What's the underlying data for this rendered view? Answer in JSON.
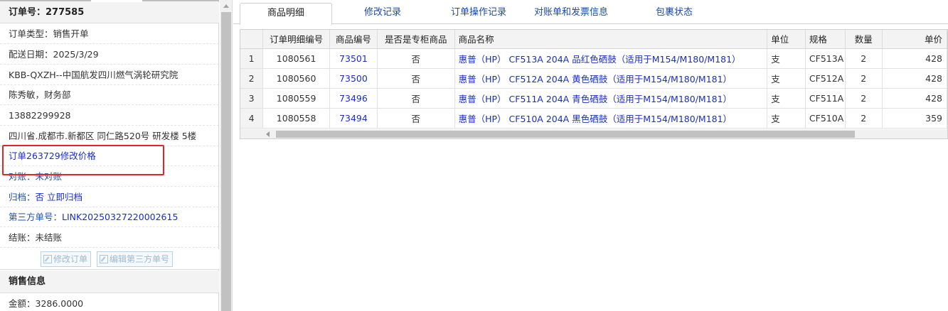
{
  "order": {
    "title": "订单号：277585",
    "fields": [
      "订单类型：销售开单",
      "配送日期：2025/3/29",
      "KBB-QXZH--中国航发四川燃气涡轮研究院",
      "陈秀敏，财务部",
      "13882299928",
      "四川省.成都市.新都区 同仁路520号 研发楼 5楼"
    ],
    "price_change_link": "订单263729修改价格",
    "reconcile": "对账：未对账",
    "archive_label": "归档：",
    "archive_value": "否 立即归档",
    "third_party_label": "第三方单号：",
    "third_party_value": "LINK20250327220002615",
    "settlement": "结账：未结账",
    "buttons": {
      "edit_order": "修改订单",
      "edit_third_party": "编辑第三方单号"
    }
  },
  "sales": {
    "title": "销售信息",
    "amount": "金额：3286.0000"
  },
  "tabs": [
    "商品明细",
    "修改记录",
    "订单操作记录",
    "对账单和发票信息",
    "包裹状态"
  ],
  "active_tab": 0,
  "table": {
    "headers": [
      "",
      "订单明细编号",
      "商品编号",
      "是否是专柜商品",
      "商品名称",
      "单位",
      "规格",
      "数量",
      "单价"
    ],
    "rows": [
      [
        "1",
        "1080561",
        "73501",
        "否",
        "惠普（HP） CF513A 204A 品红色硒鼓（适用于M154/M180/M181）",
        "支",
        "CF513A",
        "2",
        "428"
      ],
      [
        "2",
        "1080560",
        "73500",
        "否",
        "惠普（HP） CF512A 204A 黄色硒鼓（适用于M154/M180/M181）",
        "支",
        "CF512A",
        "2",
        "428"
      ],
      [
        "3",
        "1080559",
        "73496",
        "否",
        "惠普（HP） CF511A 204A 青色硒鼓（适用于M154/M180/M181）",
        "支",
        "CF511A",
        "2",
        "428"
      ],
      [
        "4",
        "1080558",
        "73494",
        "否",
        "惠普（HP） CF510A 204A 黑色硒鼓（适用于M154/M180/M181）",
        "支",
        "CF510A",
        "2",
        "359"
      ]
    ]
  },
  "colors": {
    "link": "#1a2fc2",
    "tab_link": "#1a4aa6",
    "highlight_box": "#e0262d"
  }
}
